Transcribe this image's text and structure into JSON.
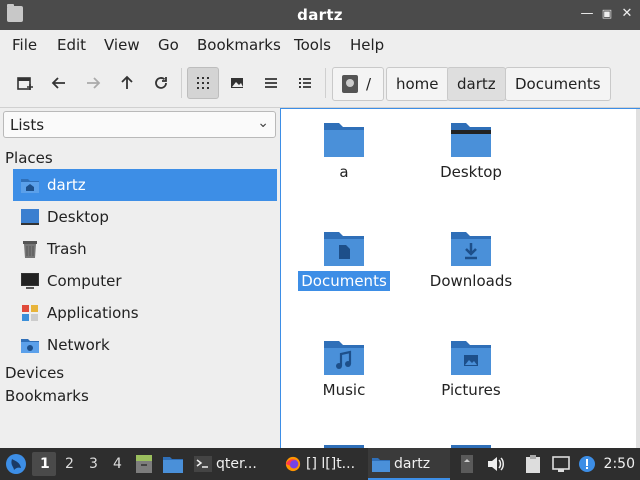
{
  "window": {
    "title": "dartz"
  },
  "menubar": [
    "File",
    "Edit",
    "View",
    "Go",
    "Bookmarks",
    "Tools",
    "Help"
  ],
  "toolbar": {
    "buttons": [
      "new-tab-icon",
      "back-icon",
      "forward-icon",
      "up-icon",
      "reload-icon",
      "icon-view-icon",
      "thumbnail-view-icon",
      "compact-view-icon",
      "detailed-list-view-icon"
    ],
    "active_view": "icon-view-icon"
  },
  "pathbar": {
    "root": "/",
    "crumbs": [
      "home",
      "dartz",
      "Documents"
    ],
    "current": "dartz"
  },
  "sidepane": {
    "mode": "Lists",
    "places_header": "Places",
    "places": [
      {
        "label": "dartz",
        "icon": "home-folder-icon",
        "selected": true
      },
      {
        "label": "Desktop",
        "icon": "desktop-icon",
        "selected": false
      },
      {
        "label": "Trash",
        "icon": "trash-icon",
        "selected": false
      },
      {
        "label": "Computer",
        "icon": "computer-icon",
        "selected": false
      },
      {
        "label": "Applications",
        "icon": "applications-icon",
        "selected": false
      },
      {
        "label": "Network",
        "icon": "network-icon",
        "selected": false
      }
    ],
    "devices_header": "Devices",
    "bookmarks_header": "Bookmarks"
  },
  "files": [
    {
      "name": "a",
      "icon": "folder-icon",
      "selected": false
    },
    {
      "name": "Desktop",
      "icon": "folder-desktop-icon",
      "selected": false
    },
    {
      "name": "Documents",
      "icon": "folder-documents-icon",
      "selected": true
    },
    {
      "name": "Downloads",
      "icon": "folder-downloads-icon",
      "selected": false
    },
    {
      "name": "Music",
      "icon": "folder-music-icon",
      "selected": false
    },
    {
      "name": "Pictures",
      "icon": "folder-pictures-icon",
      "selected": false
    }
  ],
  "taskbar": {
    "workspaces": [
      "1",
      "2",
      "3",
      "4"
    ],
    "current_workspace": "1",
    "tasks": [
      {
        "label": "qter...",
        "icon": "terminal-icon"
      },
      {
        "label": "[] l[]t...",
        "icon": "firefox-icon"
      },
      {
        "label": "dartz",
        "icon": "folder-icon"
      }
    ],
    "clock": "2:50"
  },
  "colors": {
    "accent": "#3d8ee6",
    "folder": "#4a90d9",
    "folder_dark": "#2f6fb8",
    "titlebar": "#4b4b4b",
    "taskbar": "#2e2e2e"
  }
}
